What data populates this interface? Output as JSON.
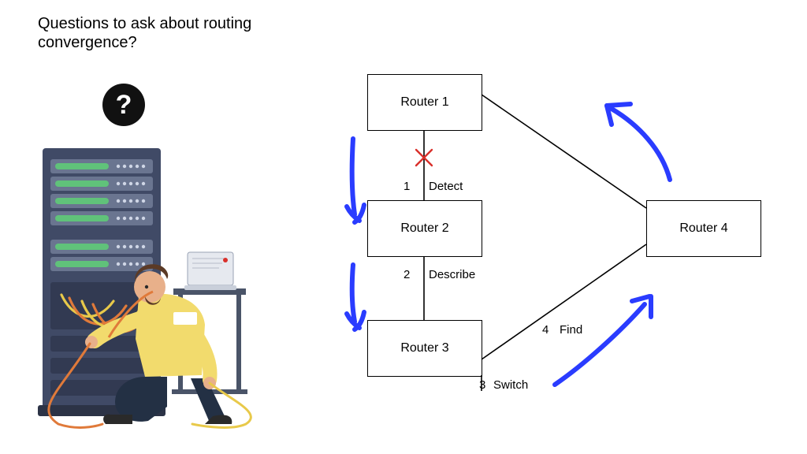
{
  "title": "Questions to ask about routing convergence?",
  "question_mark": "?",
  "routers": {
    "r1": "Router 1",
    "r2": "Router 2",
    "r3": "Router 3",
    "r4": "Router 4"
  },
  "steps": {
    "s1_num": "1",
    "s1_text": "Detect",
    "s2_num": "2",
    "s2_text": "Describe",
    "s3_num": "3",
    "s3_text": "Switch",
    "s4_num": "4",
    "s4_text": "Find"
  },
  "icons": {
    "question": "question-mark-circle-icon",
    "failure_x": "failure-x-icon",
    "server_rack": "server-rack-icon",
    "technician": "technician-icon",
    "laptop": "laptop-icon",
    "arrow": "curved-arrow-icon"
  },
  "colors": {
    "arrow_blue": "#2a3cff",
    "failure_red": "#d9302b",
    "rack_body": "#404a66",
    "rack_panel": "#6a7590",
    "rack_led": "#60c27a",
    "shirt": "#f2db6d",
    "pants": "#233044",
    "skin": "#e8b08a",
    "hair": "#5b3a26",
    "cable_orange": "#e07a3a",
    "cable_yellow": "#e8c94a"
  }
}
